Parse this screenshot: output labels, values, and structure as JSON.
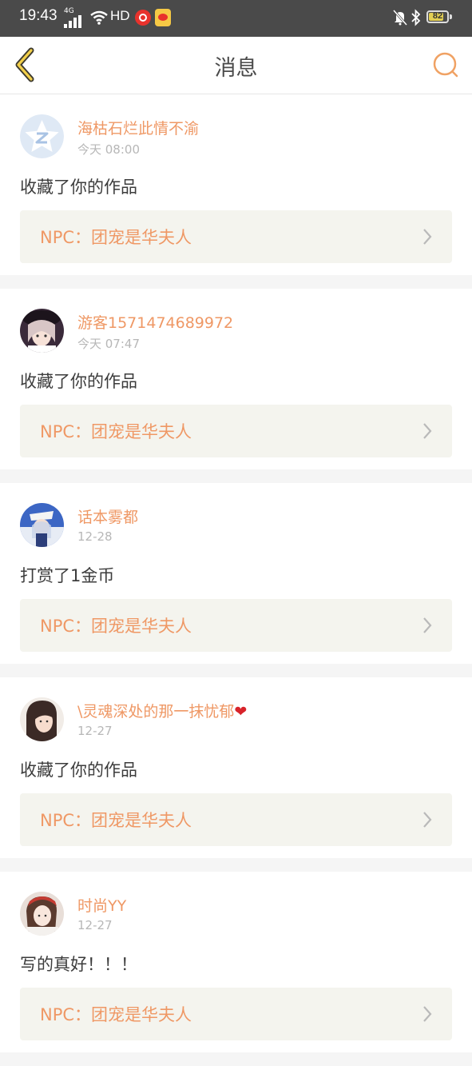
{
  "status_bar": {
    "time": "19:43",
    "network": "4G",
    "hd": "HD",
    "battery": "82",
    "battery_level": 0.82
  },
  "header": {
    "title": "消息",
    "back_icon": "chevron-left-icon",
    "search_icon": "search-icon",
    "accent_color": "#f0a264"
  },
  "messages": [
    {
      "username": "海枯石烂此情不渝",
      "time": "今天 08:00",
      "action": "收藏了你的作品",
      "work": "NPC：团宠是华夫人",
      "avatar": "default-avatar-icon"
    },
    {
      "username": "游客1571474689972",
      "time": "今天 07:47",
      "action": "收藏了你的作品",
      "work": "NPC：团宠是华夫人",
      "avatar": "user-avatar"
    },
    {
      "username": "话本雾都",
      "time": "12-28",
      "action": "打赏了1金币",
      "work": "NPC：团宠是华夫人",
      "avatar": "user-avatar"
    },
    {
      "username": "\\灵魂深处的那一抹忧郁",
      "username_suffix": "❤",
      "time": "12-27",
      "action": "收藏了你的作品",
      "work": "NPC：团宠是华夫人",
      "avatar": "user-avatar"
    },
    {
      "username": "时尚YY",
      "time": "12-27",
      "action": "写的真好！！！",
      "work": "NPC：团宠是华夫人",
      "avatar": "user-avatar"
    }
  ],
  "colors": {
    "username": "#ef9865",
    "time": "#b7b7b7",
    "action": "#3c3c3c",
    "work_box_bg": "#f4f4ee",
    "page_bg": "#f5f5f5"
  }
}
